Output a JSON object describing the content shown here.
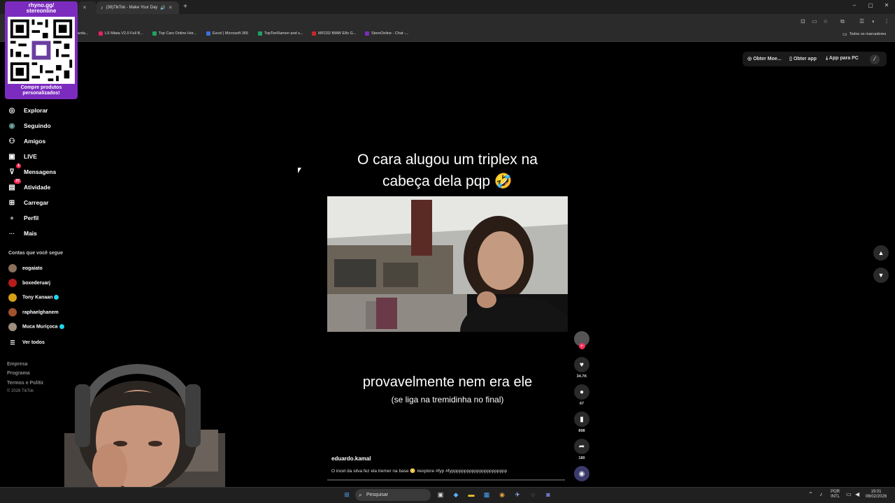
{
  "browser": {
    "tabs": [
      {
        "label": "(38)TikTok - Make Your Day",
        "active": false
      }
    ],
    "new_tab_label": "+",
    "window_controls": [
      "–",
      "▢",
      "✕"
    ]
  },
  "bookmarks": [
    {
      "label": "azda...",
      "color": "#444444"
    },
    {
      "label": "LS Miata V2.0 Full B...",
      "color": "#e0245e"
    },
    {
      "label": "Top Cars Online Hor...",
      "color": "#1ea362"
    },
    {
      "label": "Excel | Microsoft 365",
      "color": "#3b6fd8"
    },
    {
      "label": "TopTierRamen and s...",
      "color": "#1ea362"
    },
    {
      "label": "MFD32 BMW E8x G...",
      "color": "#c62828"
    },
    {
      "label": "StereOnline - Chat -...",
      "color": "#7b2cbf"
    }
  ],
  "bookmarks_all": "Todos os marcadores",
  "overlay": {
    "title_line1": "rhyno.gg/",
    "title_line2": "stereonline",
    "caption_line1": "Compre produtos",
    "caption_line2": "personalizados!"
  },
  "sidebar": {
    "items": [
      {
        "label": "Explorar",
        "icon": "compass-icon",
        "glyph": "◎"
      },
      {
        "label": "Seguindo",
        "icon": "following-avatar-icon",
        "glyph": "◉"
      },
      {
        "label": "Amigos",
        "icon": "friends-icon",
        "glyph": "⚇"
      },
      {
        "label": "LIVE",
        "icon": "live-icon",
        "glyph": "▣"
      },
      {
        "label": "Mensagens",
        "icon": "messages-icon",
        "glyph": "⊽",
        "badge": "1"
      },
      {
        "label": "Atividade",
        "icon": "activity-icon",
        "glyph": "▤",
        "badge": "37"
      },
      {
        "label": "Carregar",
        "icon": "upload-icon",
        "glyph": "⊞"
      },
      {
        "label": "Perfil",
        "icon": "profile-avatar-icon",
        "glyph": "●"
      },
      {
        "label": "Mais",
        "icon": "more-icon",
        "glyph": "···"
      }
    ],
    "following_title": "Contas que você segue",
    "accounts": [
      {
        "name": "eogaiato",
        "verified": false,
        "color": "#8a6f5a"
      },
      {
        "name": "boxederuarj",
        "verified": false,
        "color": "#b71c1c"
      },
      {
        "name": "Tony Kanaan",
        "verified": true,
        "color": "#d4a017"
      },
      {
        "name": "raphaelghanem",
        "verified": false,
        "color": "#a0522d"
      },
      {
        "name": "Muca Muriçoca",
        "verified": true,
        "color": "#9e8e7e"
      }
    ],
    "see_all": "Ver todos",
    "footer": [
      "Empresa",
      "Programa",
      "Termos e Políticas"
    ],
    "copyright": "© 2026 TikTok"
  },
  "topbar": {
    "coins": "Obter Moe...",
    "app": "Obter app",
    "pc": "App para PC"
  },
  "video": {
    "caption_top_line1": "O cara alugou um triplex na",
    "caption_top_line2": "cabeça dela pqp 🤣",
    "caption_bottom": "provavelmente nem era ele",
    "caption_bottom_sub": "(se liga na tremidinha no final)",
    "author": "eduardo.kamal",
    "description": "O incel da silva fez ela tremer na base 😳 #explore #fyp #fypppppppppppppppppppppp"
  },
  "actions": {
    "likes": "34.7K",
    "comments": "67",
    "saves": "898",
    "shares": "180"
  },
  "taskbar": {
    "search_placeholder": "Pesquisar",
    "lang_line1": "POR",
    "lang_line2": "INTL",
    "time": "19:01",
    "date": "06/02/2026"
  }
}
